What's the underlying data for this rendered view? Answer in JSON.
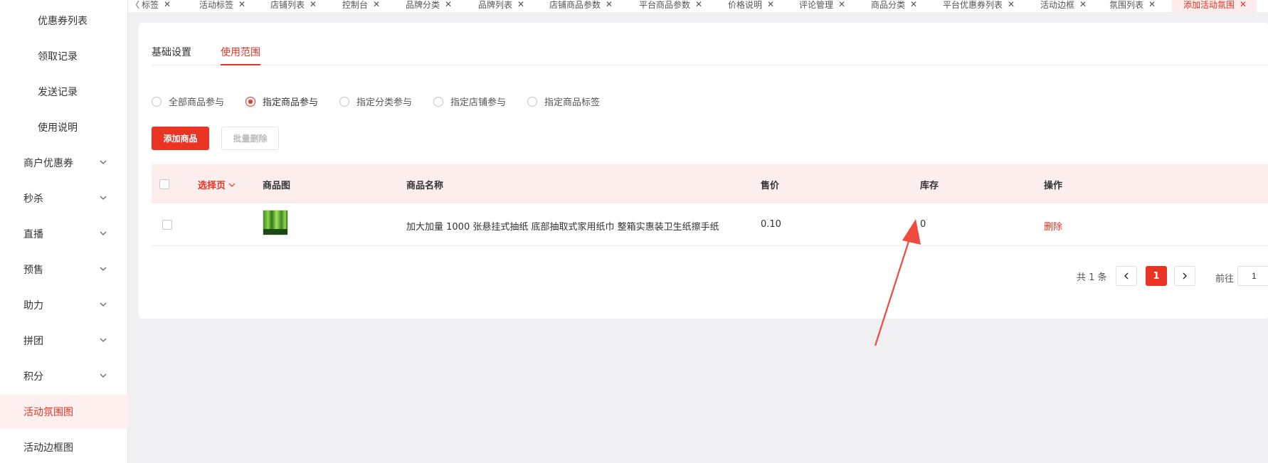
{
  "tabbar": {
    "prev_label": "〈",
    "tabs": [
      {
        "label": "标签",
        "active": false
      },
      {
        "label": "活动标签",
        "active": false
      },
      {
        "label": "店铺列表",
        "active": false
      },
      {
        "label": "控制台",
        "active": false
      },
      {
        "label": "品牌分类",
        "active": false
      },
      {
        "label": "品牌列表",
        "active": false
      },
      {
        "label": "店铺商品参数",
        "active": false
      },
      {
        "label": "平台商品参数",
        "active": false
      },
      {
        "label": "价格说明",
        "active": false
      },
      {
        "label": "评论管理",
        "active": false
      },
      {
        "label": "商品分类",
        "active": false
      },
      {
        "label": "平台优惠券列表",
        "active": false
      },
      {
        "label": "活动边框",
        "active": false
      },
      {
        "label": "氛围列表",
        "active": false
      },
      {
        "label": "添加活动氛围",
        "active": true
      }
    ],
    "close_glyph": "✕"
  },
  "sidebar": {
    "items": [
      {
        "label": "优惠券列表",
        "level": "sub",
        "has_chevron": false,
        "active": false
      },
      {
        "label": "领取记录",
        "level": "sub",
        "has_chevron": false,
        "active": false
      },
      {
        "label": "发送记录",
        "level": "sub",
        "has_chevron": false,
        "active": false
      },
      {
        "label": "使用说明",
        "level": "sub",
        "has_chevron": false,
        "active": false
      },
      {
        "label": "商户优惠券",
        "level": "top",
        "has_chevron": true,
        "active": false
      },
      {
        "label": "秒杀",
        "level": "top",
        "has_chevron": true,
        "active": false
      },
      {
        "label": "直播",
        "level": "top",
        "has_chevron": true,
        "active": false
      },
      {
        "label": "预售",
        "level": "top",
        "has_chevron": true,
        "active": false
      },
      {
        "label": "助力",
        "level": "top",
        "has_chevron": true,
        "active": false
      },
      {
        "label": "拼团",
        "level": "top",
        "has_chevron": true,
        "active": false
      },
      {
        "label": "积分",
        "level": "top",
        "has_chevron": true,
        "active": false
      },
      {
        "label": "活动氛围图",
        "level": "top",
        "has_chevron": false,
        "active": true
      },
      {
        "label": "活动边框图",
        "level": "top",
        "has_chevron": false,
        "active": false
      }
    ]
  },
  "subtabs": {
    "items": [
      {
        "label": "基础设置",
        "active": false
      },
      {
        "label": "使用范围",
        "active": true
      }
    ]
  },
  "scope": {
    "options": [
      {
        "label": "全部商品参与",
        "checked": false
      },
      {
        "label": "指定商品参与",
        "checked": true
      },
      {
        "label": "指定分类参与",
        "checked": false
      },
      {
        "label": "指定店铺参与",
        "checked": false
      },
      {
        "label": "指定商品标签",
        "checked": false
      }
    ]
  },
  "actions": {
    "add_label": "添加商品",
    "batch_delete_label": "批量删除"
  },
  "table": {
    "select_page_label": "选择页",
    "columns": [
      "商品图",
      "商品名称",
      "售价",
      "库存",
      "操作"
    ],
    "rows": [
      {
        "name": "加大加量 1000 张悬挂式抽纸 底部抽取式家用纸巾 整箱实惠装卫生纸擦手纸",
        "price": "0.10",
        "stock": "0",
        "action": "删除"
      }
    ]
  },
  "pagination": {
    "total_label": "共 1 条",
    "current_page": "1",
    "goto_label": "前往",
    "goto_value": "1"
  },
  "colors": {
    "accent": "#e93323",
    "annotation_arrow": "#f04a3e"
  }
}
